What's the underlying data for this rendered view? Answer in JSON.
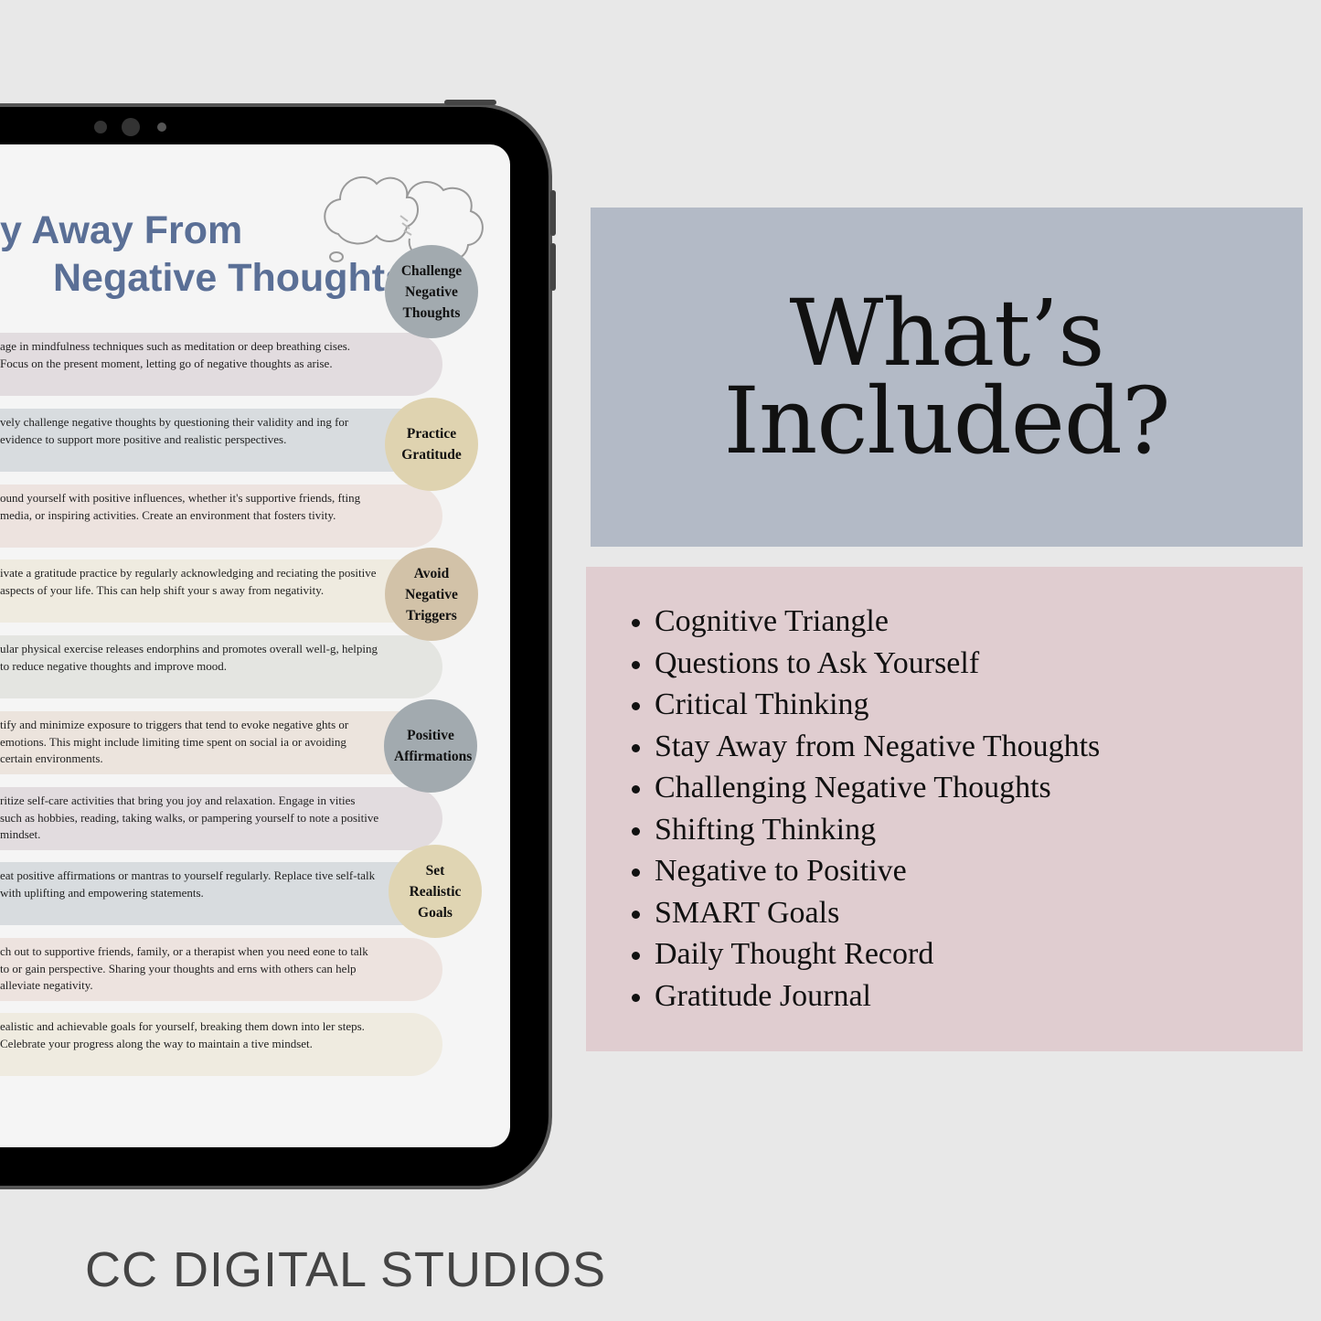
{
  "planner": {
    "title_line1": "y Away From",
    "title_line2": "Negative Thoughts",
    "rows": [
      {
        "text": "age in mindfulness techniques such as meditation or deep breathing cises. Focus on the present moment, letting go of negative thoughts as arise.",
        "color": "#e2dcdf",
        "badge": ""
      },
      {
        "text": "vely challenge negative thoughts by questioning their validity and ing for evidence to support more positive and realistic perspectives.",
        "color": "#d8dcdf",
        "badge": "Challenge Negative Thoughts",
        "badge_color": "#a2aaaf"
      },
      {
        "text": "ound yourself with positive influences, whether it's supportive friends, fting media, or inspiring activities. Create an environment that fosters tivity.",
        "color": "#ede3df",
        "badge": ""
      },
      {
        "text": "ivate a gratitude practice by regularly acknowledging and reciating the positive aspects of your life. This can help shift your s away from negativity.",
        "color": "#efebe0",
        "badge": "Practice Gratitude",
        "badge_color": "#dfd3b0"
      },
      {
        "text": "ular physical exercise releases endorphins and promotes overall well-g, helping to reduce negative thoughts and improve mood.",
        "color": "#e4e5e1",
        "badge": ""
      },
      {
        "text": "tify and minimize exposure to triggers that tend to evoke negative ghts or emotions. This might include limiting time spent on social ia or avoiding certain environments.",
        "color": "#ece4dd",
        "badge": "Avoid Negative Triggers",
        "badge_color": "#d2c2a8"
      },
      {
        "text": "ritize self-care activities that bring you joy and relaxation. Engage in vities such as hobbies, reading, taking walks, or pampering yourself to note a positive mindset.",
        "color": "#e2dcdf",
        "badge": ""
      },
      {
        "text": "eat positive affirmations or mantras to yourself regularly. Replace tive self-talk with uplifting and empowering statements.",
        "color": "#d8dcdf",
        "badge": "Positive Affirmations",
        "badge_color": "#a2aaaf"
      },
      {
        "text": "ch out to supportive friends, family, or a therapist when you need eone to talk to or gain perspective. Sharing your thoughts and erns with others can help alleviate negativity.",
        "color": "#ede3df",
        "badge": ""
      },
      {
        "text": "ealistic and achievable goals for yourself, breaking them down into ler steps. Celebrate your progress along the way to maintain a tive mindset.",
        "color": "#efebe0",
        "badge": "Set Realistic Goals",
        "badge_color": "#e0d5b3"
      }
    ],
    "icon": "thought-cloud-icon"
  },
  "included": {
    "heading": "What’s Included?",
    "heading_bg": "#b3bac6",
    "list_bg": "#e0cdd0",
    "items": [
      "Cognitive Triangle",
      "Questions to Ask Yourself",
      "Critical Thinking",
      "Stay Away from Negative Thoughts",
      "Challenging Negative Thoughts",
      "Shifting Thinking",
      "Negative to Positive",
      "SMART Goals",
      "Daily Thought Record",
      "Gratitude Journal"
    ]
  },
  "brand": "CC DIGITAL STUDIOS",
  "title_color": "#5a6f96"
}
